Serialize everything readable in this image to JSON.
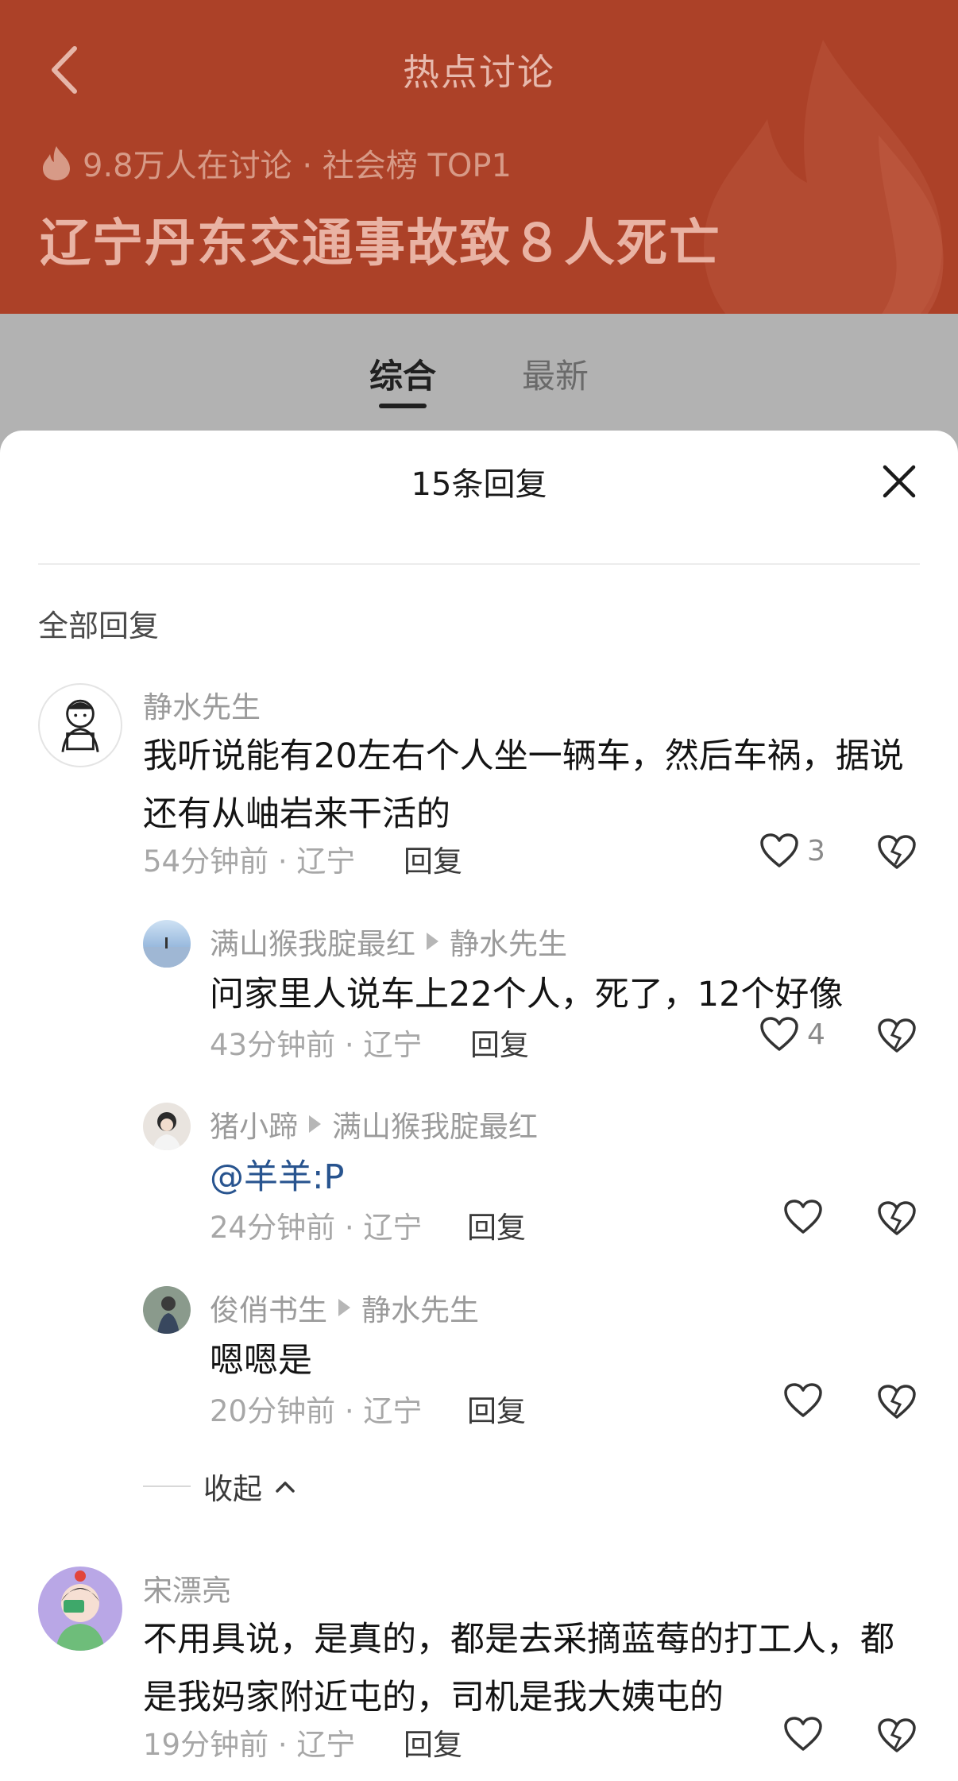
{
  "header": {
    "title": "热点讨论",
    "meta": "9.8万人在讨论 · 社会榜 TOP1",
    "headline": "辽宁丹东交通事故致８人死亡",
    "background_color": "#ac4128"
  },
  "tabs": [
    {
      "label": "综合",
      "active": true
    },
    {
      "label": "最新",
      "active": false
    }
  ],
  "sheet": {
    "title": "15条回复",
    "section_label": "全部回复",
    "collapse_label": "收起"
  },
  "comments": [
    {
      "user": "静水先生",
      "text": "我听说能有20左右个人坐一辆车，然后车祸，据说还有从岫岩来干活的",
      "time": "54分钟前 · 辽宁",
      "reply_label": "回复",
      "likes": "3"
    },
    {
      "user": "满山猴我腚最红",
      "reply_to": "静水先生",
      "text": "问家里人说车上22个人，死了，12个好像",
      "time": "43分钟前 · 辽宁",
      "reply_label": "回复",
      "likes": "4"
    },
    {
      "user": "猪小蹄",
      "reply_to": "满山猴我腚最红",
      "text": "@羊羊:P",
      "time": "24分钟前 · 辽宁",
      "reply_label": "回复"
    },
    {
      "user": "俊俏书生",
      "reply_to": "静水先生",
      "text": "嗯嗯是",
      "time": "20分钟前 · 辽宁",
      "reply_label": "回复"
    },
    {
      "user": "宋漂亮",
      "text": "不用具说，是真的，都是去采摘蓝莓的打工人，都是我妈家附近屯的，司机是我大姨屯的",
      "time": "19分钟前 · 辽宁",
      "reply_label": "回复"
    }
  ],
  "icons": {
    "back": "chevron-left-icon",
    "close": "close-icon",
    "like": "heart-outline-icon",
    "dislike": "broken-heart-icon",
    "flame": "flame-icon"
  }
}
